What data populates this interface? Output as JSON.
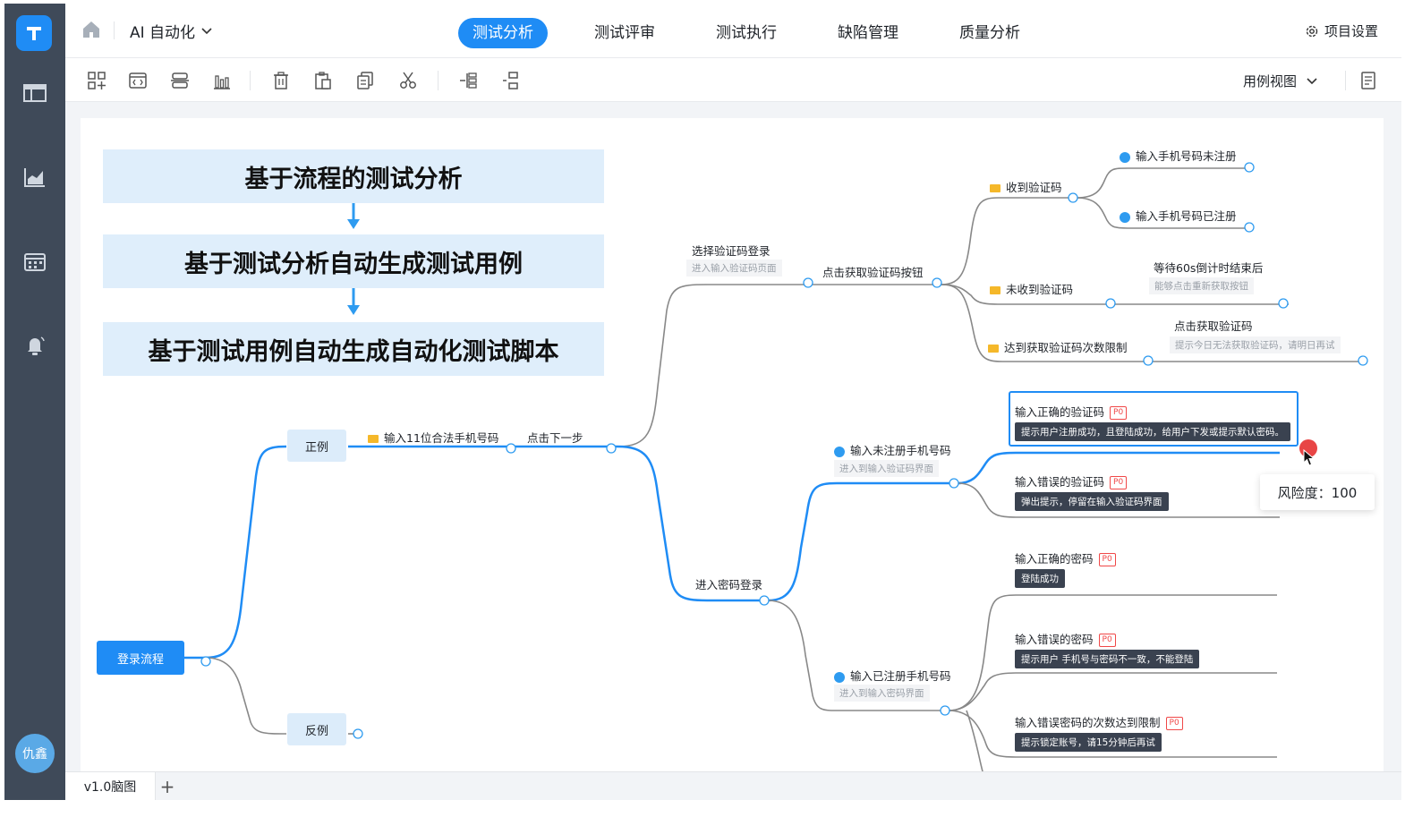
{
  "header": {
    "project": "AI 自动化",
    "tabs": [
      "测试分析",
      "测试评审",
      "测试执行",
      "缺陷管理",
      "质量分析"
    ],
    "settings": "项目设置"
  },
  "toolbar": {
    "view": "用例视图"
  },
  "user": {
    "avatar_text": "仇鑫"
  },
  "steps": [
    "基于流程的测试分析",
    "基于测试分析自动生成测试用例",
    "基于测试用例自动生成自动化测试脚本"
  ],
  "mindmap": {
    "root": "登录流程",
    "positive": "正例",
    "negative": "反例",
    "input_phone": "输入11位合法手机号码",
    "next_step": "点击下一步",
    "sms_login": "选择验证码登录",
    "sms_login_sub": "进入输入验证码页面",
    "get_code": "点击获取验证码按钮",
    "got_code": "收到验证码",
    "unregistered": "输入手机号码未注册",
    "registered": "输入手机号码已注册",
    "no_code": "未收到验证码",
    "wait_60": "等待60s倒计时结束后",
    "wait_60_sub": "能够点击重新获取按钮",
    "limit": "达到获取验证码次数限制",
    "click_get": "点击获取验证码",
    "click_get_sub": "提示今日无法获取验证码，请明日再试",
    "pwd_login": "进入密码登录",
    "unreg_phone": "输入未注册手机号码",
    "unreg_phone_sub": "进入到输入验证码界面",
    "correct_code": "输入正确的验证码",
    "correct_code_res": "提示用户注册成功，且登陆成功，给用户下发或提示默认密码。",
    "wrong_code": "输入错误的验证码",
    "wrong_code_res": "弹出提示，停留在输入验证码界面",
    "correct_pwd": "输入正确的密码",
    "correct_pwd_res": "登陆成功",
    "wrong_pwd": "输入错误的密码",
    "wrong_pwd_res": "提示用户 手机号与密码不一致，不能登陆",
    "reg_phone": "输入已注册手机号码",
    "reg_phone_sub": "进入到输入密码界面",
    "wrong_pwd_limit": "输入错误密码的次数达到限制",
    "wrong_pwd_limit_res": "提示锁定账号，请15分钟后再试",
    "priority": "P0",
    "risk": "风险度：100"
  },
  "bottom": {
    "tab": "v1.0脑图",
    "add": "+"
  }
}
